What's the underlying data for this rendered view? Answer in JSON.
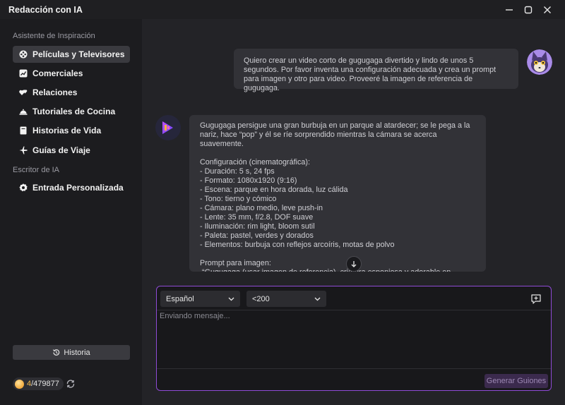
{
  "window": {
    "title": "Redacción con IA"
  },
  "sidebar": {
    "section1": "Asistente de Inspiración",
    "section2": "Escritor de IA",
    "items": [
      {
        "label": "Películas y Televisores",
        "icon": "film-reel-icon"
      },
      {
        "label": "Comerciales",
        "icon": "trend-chart-icon"
      },
      {
        "label": "Relaciones",
        "icon": "hearts-icon"
      },
      {
        "label": "Tutoriales de Cocina",
        "icon": "cloche-icon"
      },
      {
        "label": "Historias de Vida",
        "icon": "book-icon"
      },
      {
        "label": "Guías de Viaje",
        "icon": "airplane-icon"
      }
    ],
    "custom_item": {
      "label": "Entrada Personalizada",
      "icon": "gear-icon"
    },
    "history_label": "Historia",
    "credits": {
      "used": "4",
      "total": "/479877"
    }
  },
  "chat": {
    "user_message": "Quiero crear un video corto de gugugaga divertido y lindo de unos 5 segundos. Por favor inventa una configuración adecuada y crea un prompt para imagen y otro para video. Proveeré la imagen de referencia de gugugaga.",
    "ai_message": "Gugugaga persigue una gran burbuja en un parque al atardecer; se le pega a la nariz, hace “pop” y él se ríe sorprendido mientras la cámara se acerca suavemente.\n\nConfiguración (cinematográfica):\n- Duración: 5 s, 24 fps\n- Formato: 1080x1920 (9:16)\n- Escena: parque en hora dorada, luz cálida\n- Tono: tierno y cómico\n- Cámara: plano medio, leve push-in\n- Lente: 35 mm, f/2.8, DOF suave\n- Iluminación: rim light, bloom sutil\n- Paleta: pastel, verdes y dorados\n- Elementos: burbuja con reflejos arcoíris, motas de polvo\n\nPrompt para imagen:\n “Gugugaga (usar imagen de referencia), criatura esponjosa y adorable en parque al atardecer, burbuja grande junto a su nariz, expresión curiosa y divertida, luz cálida, bokeh suave, 35mm, f/2.8, rim light, colores pastel, estilo cinematográfico, alta nitidez"
  },
  "composer": {
    "language": "Español",
    "length": "<200",
    "placeholder": "Enviando mensaje...",
    "generate_label": "Generar Guiones"
  },
  "colors": {
    "accent_border": "#8f4bd6",
    "credits_used": "#f0b64a"
  }
}
